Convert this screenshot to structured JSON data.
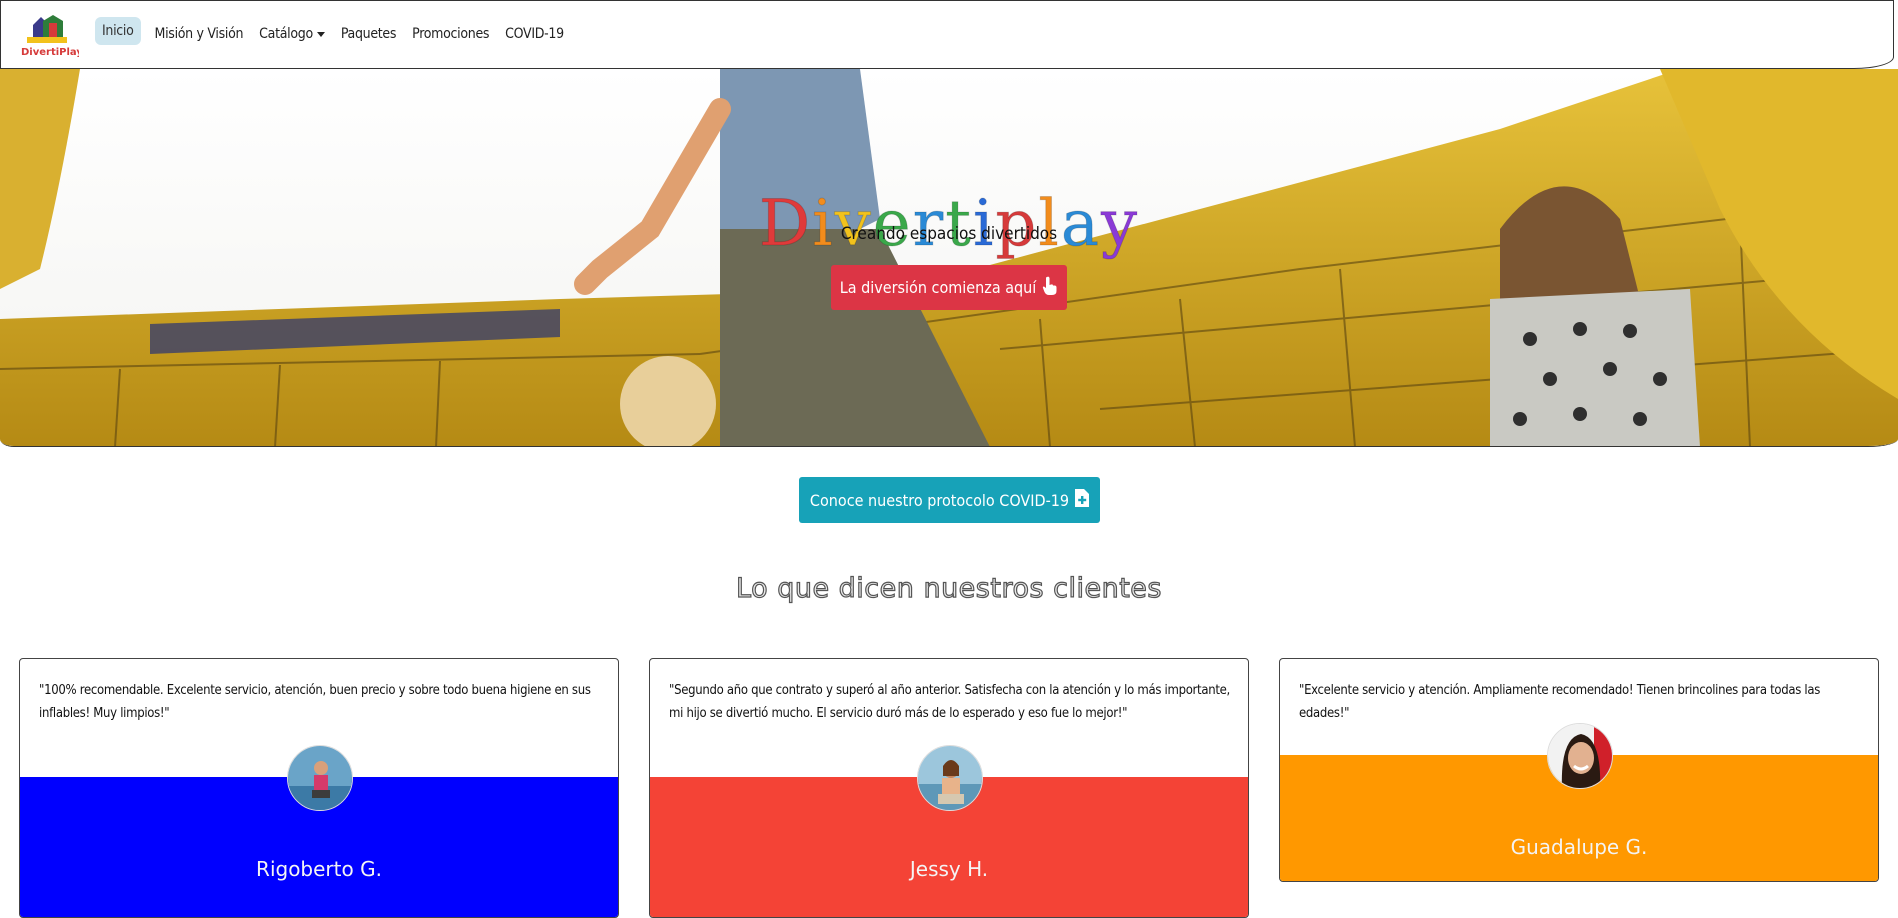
{
  "nav": {
    "logo_text": "DivertiPlay",
    "items": [
      {
        "label": "Inicio",
        "active": true
      },
      {
        "label": "Misión y Visión"
      },
      {
        "label": "Catálogo",
        "dropdown": true
      },
      {
        "label": "Paquetes"
      },
      {
        "label": "Promociones"
      },
      {
        "label": "COVID-19"
      }
    ]
  },
  "hero": {
    "title_letters": [
      {
        "char": "D",
        "color": "#e03a3a"
      },
      {
        "char": "i",
        "color": "#f28c1c"
      },
      {
        "char": "v",
        "color": "#f2c21c"
      },
      {
        "char": "e",
        "color": "#3aa84a"
      },
      {
        "char": "r",
        "color": "#2a8ad6"
      },
      {
        "char": "t",
        "color": "#3aa84a"
      },
      {
        "char": "i",
        "color": "#2a6ad6"
      },
      {
        "char": "p",
        "color": "#d63a3a"
      },
      {
        "char": "l",
        "color": "#f28c1c"
      },
      {
        "char": "a",
        "color": "#2a8ad6"
      },
      {
        "char": "y",
        "color": "#8a3ad6"
      }
    ],
    "subtitle": "Creando espacios divertidos",
    "cta_label": "La diversión comienza aquí",
    "cta_icon": "pointer-hand-icon"
  },
  "covid": {
    "button_label": "Conoce nuestro protocolo COVID-19",
    "icon": "file-medical-icon"
  },
  "testimonials": {
    "title": "Lo que dicen nuestros clientes",
    "items": [
      {
        "quote": "\"100% recomendable. Excelente servicio, atención, buen precio y sobre todo buena higiene en sus inflables! Muy limpios!\"",
        "name": "Rigoberto G.",
        "band_color": "#0000ff"
      },
      {
        "quote": "\"Segundo año que contrato y superó al año anterior. Satisfecha con la atención y lo más importante, mi hijo se divertió mucho. El servicio duró más de lo esperado y eso fue lo mejor!\"",
        "name": "Jessy H.",
        "band_color": "#f44336"
      },
      {
        "quote": "\"Excelente servicio y atención. Ampliamente recomendado! Tienen brincolines para todas las edades!\"",
        "name": "Guadalupe G.",
        "band_color": "#ff9800"
      }
    ]
  }
}
